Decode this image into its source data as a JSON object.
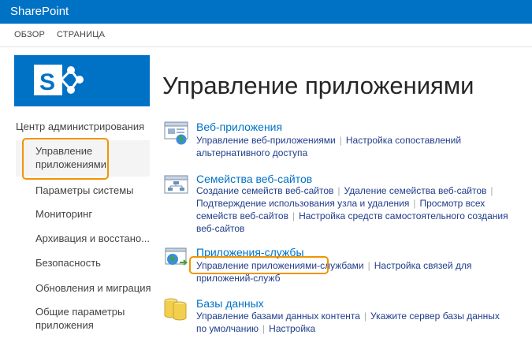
{
  "app": {
    "title": "SharePoint"
  },
  "ribbon": {
    "tabs": [
      "ОБЗОР",
      "СТРАНИЦА"
    ]
  },
  "page": {
    "title": "Управление приложениями"
  },
  "nav": {
    "header": "Центр администрирования",
    "selected": [
      "Управление",
      "приложениями"
    ],
    "items": [
      "Параметры системы",
      "Мониторинг",
      "Архивация и восстано...",
      "Безопасность",
      "Обновления и миграция"
    ],
    "last": [
      "Общие параметры",
      "приложения"
    ]
  },
  "sections": {
    "web": {
      "title": "Веб-приложения",
      "link1": "Управление веб-приложениями",
      "link2a": "Настройка сопоставлений",
      "link2b": "альтернативного доступа"
    },
    "sites": {
      "title": "Семейства веб-сайтов",
      "link1": "Создание семейств веб-сайтов",
      "link2": "Удаление семейства веб-сайтов",
      "link3": "Подтверждение использования узла и удаления",
      "link4a": "Просмотр всех",
      "link4b": "семейств веб-сайтов",
      "link5a": "Настройка средств самостоятельного создания",
      "link5b": "веб-сайтов"
    },
    "services": {
      "title": "Приложения-службы",
      "link1": "Управление приложениями-службами",
      "link2a": "Настройка связей для",
      "link2b": "приложений-служб"
    },
    "db": {
      "title": "Базы данных",
      "link1": "Управление базами данных контента",
      "link2a": "Укажите сервер базы данных",
      "link2b": "по умолчанию",
      "link3": "Настройка"
    }
  }
}
